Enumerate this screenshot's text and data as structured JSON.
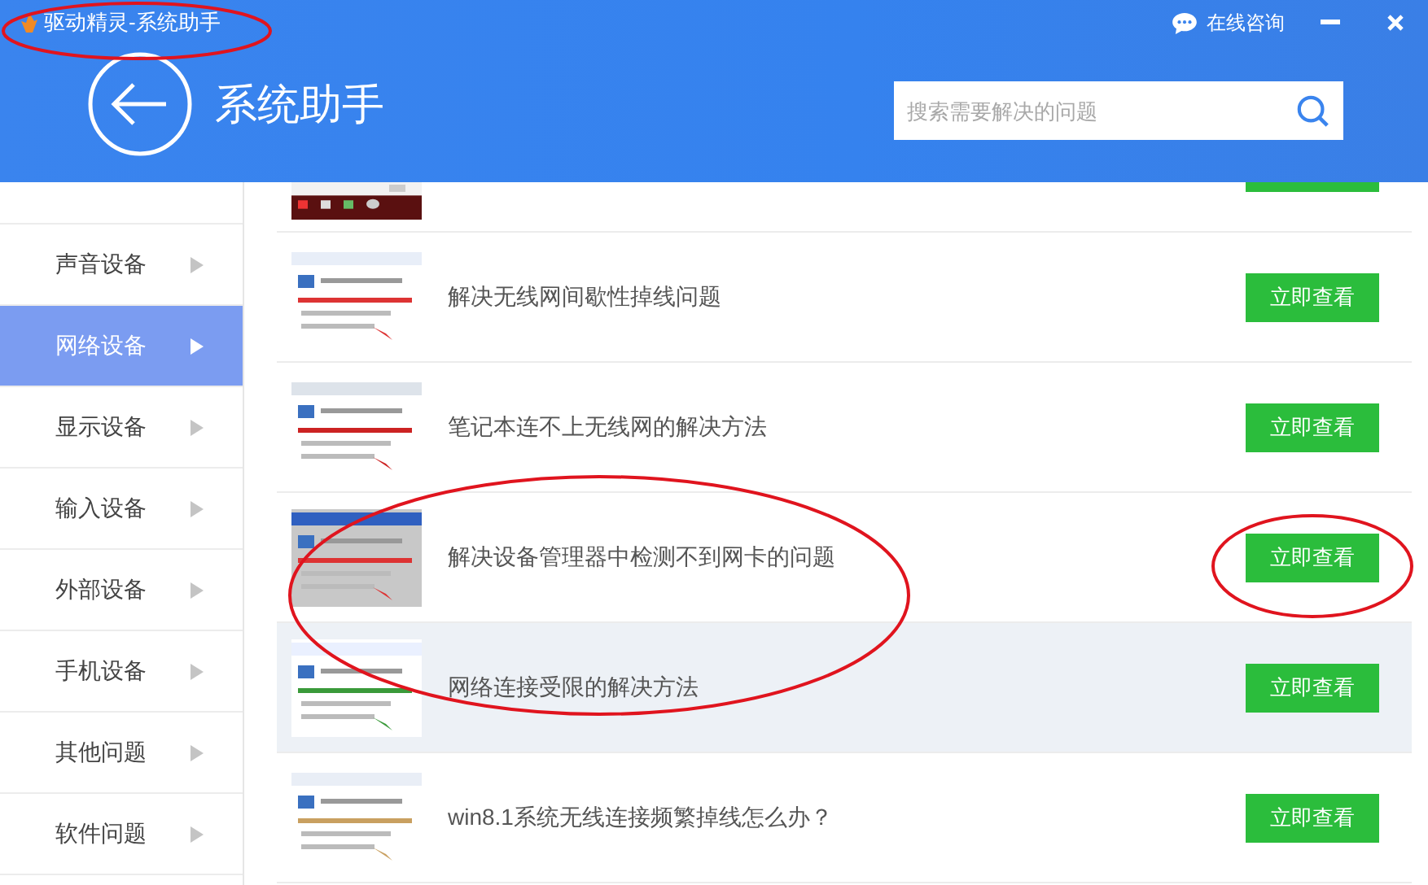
{
  "window": {
    "title": "驱动精灵-系统助手",
    "consult": "在线咨询"
  },
  "header": {
    "title": "系统助手"
  },
  "search": {
    "placeholder": "搜索需要解决的问题"
  },
  "sidebar": {
    "items": [
      {
        "label": "声音设备",
        "selected": false
      },
      {
        "label": "网络设备",
        "selected": true
      },
      {
        "label": "显示设备",
        "selected": false
      },
      {
        "label": "输入设备",
        "selected": false
      },
      {
        "label": "外部设备",
        "selected": false
      },
      {
        "label": "手机设备",
        "selected": false
      },
      {
        "label": "其他问题",
        "selected": false
      },
      {
        "label": "软件问题",
        "selected": false
      }
    ]
  },
  "articles": [
    {
      "kind": "partial"
    },
    {
      "kind": "full",
      "title": "解决无线网间歇性掉线问题",
      "button": "立即查看",
      "hovered": false
    },
    {
      "kind": "full",
      "title": "笔记本连不上无线网的解决方法",
      "button": "立即查看",
      "hovered": false
    },
    {
      "kind": "full",
      "title": "解决设备管理器中检测不到网卡的问题",
      "button": "立即查看",
      "hovered": false
    },
    {
      "kind": "full",
      "title": "网络连接受限的解决方法",
      "button": "立即查看",
      "hovered": true
    },
    {
      "kind": "full",
      "title": "win8.1系统无线连接频繁掉线怎么办？",
      "button": "立即查看",
      "hovered": false
    }
  ]
}
